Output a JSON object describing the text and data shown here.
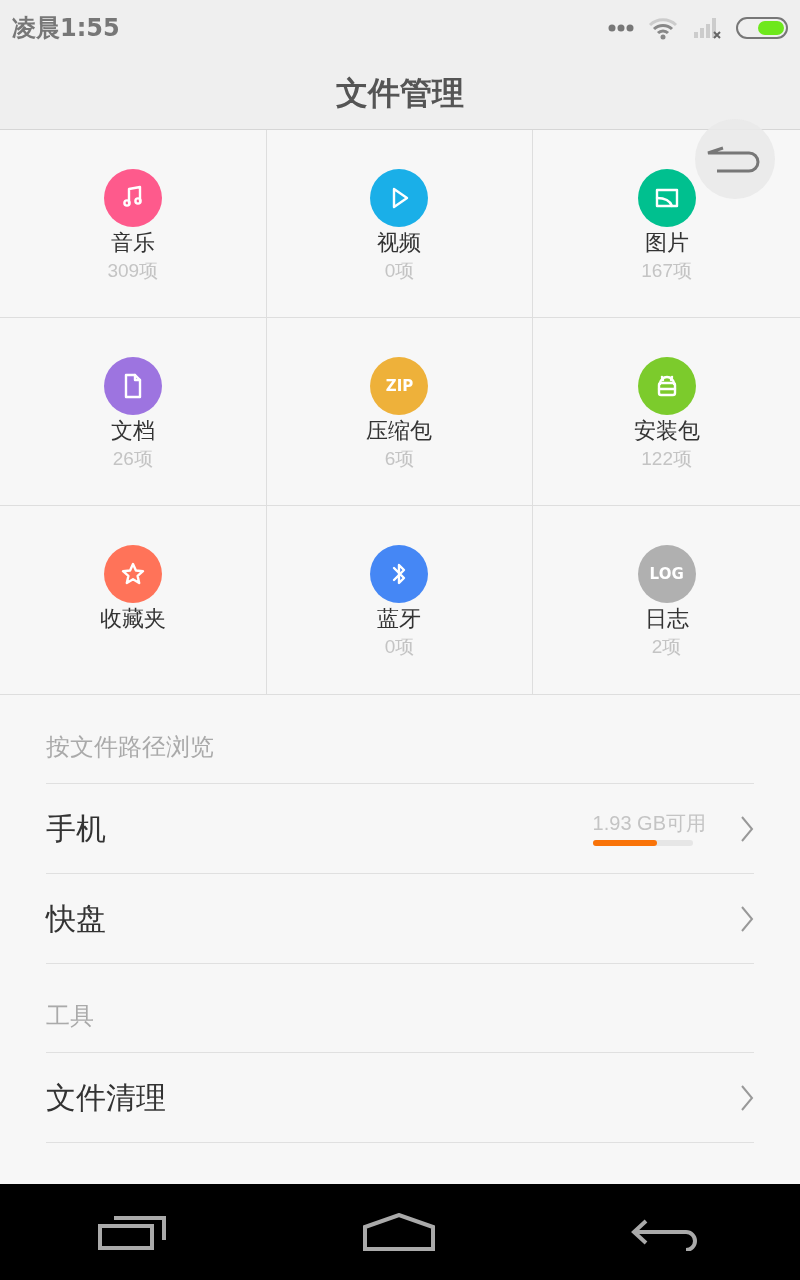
{
  "status_bar": {
    "time": "凌晨1:55"
  },
  "title": "文件管理",
  "categories": [
    {
      "kind": "music",
      "label": "音乐",
      "count": "309项",
      "color": "#fe5a8c"
    },
    {
      "kind": "video",
      "label": "视频",
      "count": "0项",
      "color": "#1aafe8"
    },
    {
      "kind": "image",
      "label": "图片",
      "count": "167项",
      "color": "#00c08f"
    },
    {
      "kind": "document",
      "label": "文档",
      "count": "26项",
      "color": "#9d74e0"
    },
    {
      "kind": "zip",
      "label": "压缩包",
      "count": "6项",
      "color": "#eeb13a",
      "badge": "ZIP"
    },
    {
      "kind": "apk",
      "label": "安装包",
      "count": "122项",
      "color": "#7ccb2c"
    },
    {
      "kind": "star",
      "label": "收藏夹",
      "color": "#ff7359"
    },
    {
      "kind": "bluetooth",
      "label": "蓝牙",
      "count": "0项",
      "color": "#4587f5"
    },
    {
      "kind": "log",
      "label": "日志",
      "count": "2项",
      "color": "#b0b0b0",
      "badge": "LOG"
    }
  ],
  "sections": [
    {
      "header": "按文件路径浏览",
      "rows": [
        {
          "label": "手机",
          "storage": "1.93 GB可用",
          "level": 0.64
        },
        {
          "label": "快盘"
        }
      ]
    },
    {
      "header": "工具",
      "rows": [
        {
          "label": "文件清理"
        }
      ]
    }
  ]
}
